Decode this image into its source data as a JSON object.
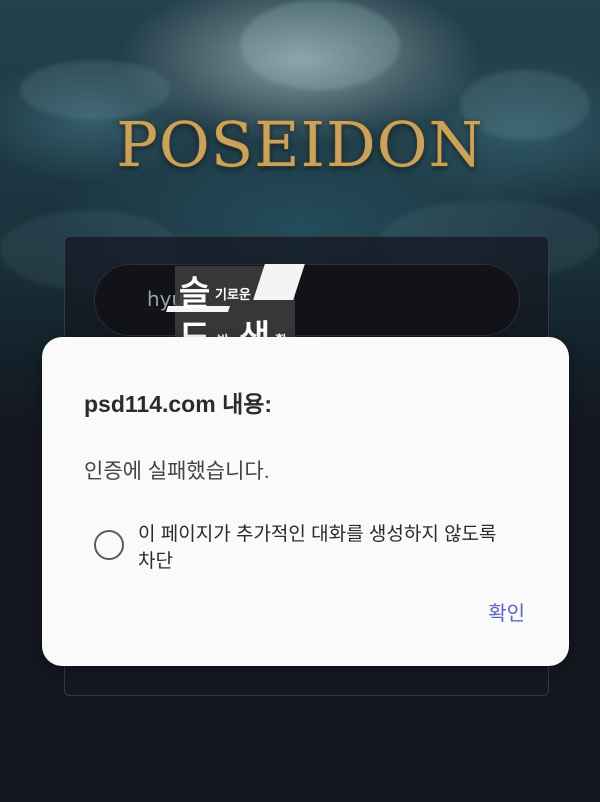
{
  "page": {
    "brand_logo": "POSEIDON",
    "login": {
      "id_value": "hyu"
    },
    "watermark": {
      "line1_big": "슬",
      "line1_small": "기로운",
      "line2_big_left": "도",
      "line2_small_left": "박",
      "line2_big_right": "생",
      "line2_small_right": "활"
    }
  },
  "dialog": {
    "title": "psd114.com 내용:",
    "message": "인증에 실패했습니다.",
    "checkbox_label": "이 페이지가 추가적인 대화를 생성하지 않도록 차단",
    "checkbox_checked": false,
    "ok_label": "확인"
  },
  "colors": {
    "logo_gold": "#c9a35c",
    "dialog_bg": "#fafafa",
    "ok_accent": "#5a63c6",
    "page_bg": "#14171f"
  }
}
